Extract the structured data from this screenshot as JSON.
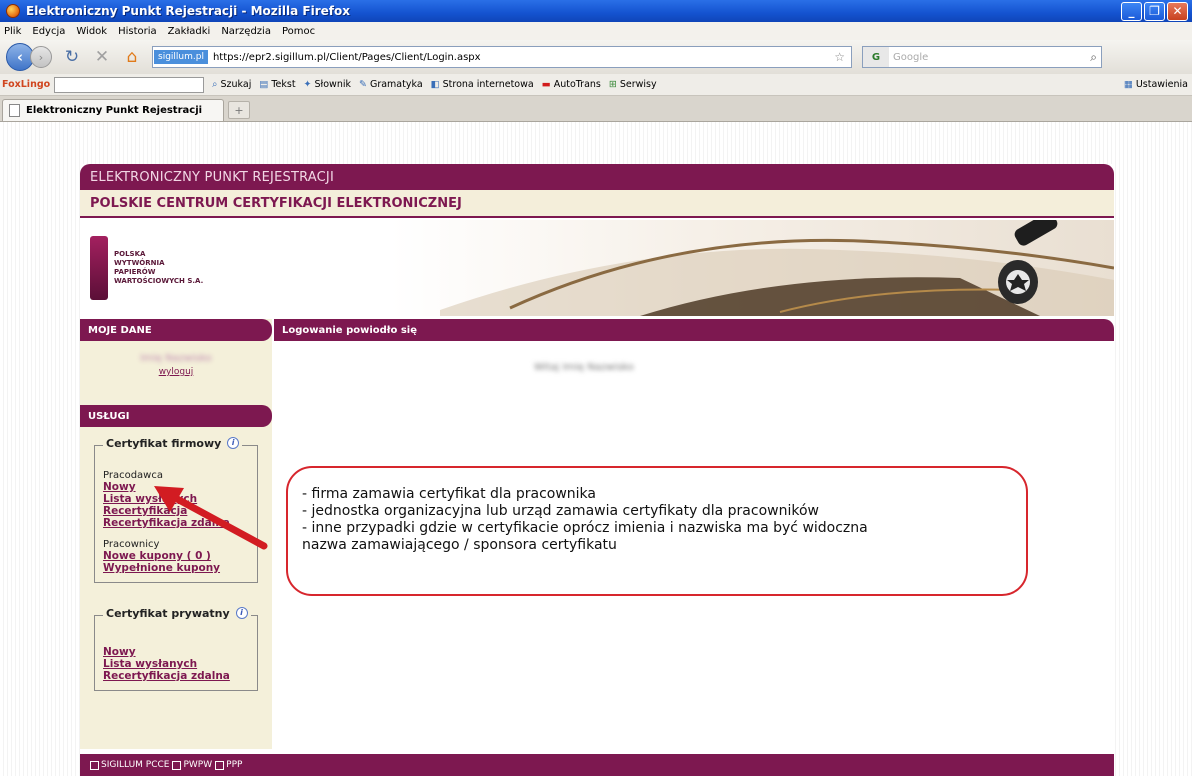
{
  "browser": {
    "title": "Elektroniczny Punkt Rejestracji - Mozilla Firefox",
    "menu": [
      "Plik",
      "Edycja",
      "Widok",
      "Historia",
      "Zakładki",
      "Narzędzia",
      "Pomoc"
    ],
    "site_identity": "sigillum.pl",
    "url": "https://epr2.sigillum.pl/Client/Pages/Client/Login.aspx",
    "search_placeholder": "Google",
    "foxlingo": {
      "brand": "FoxLingo",
      "items": [
        "Szukaj",
        "Tekst",
        "Słownik",
        "Gramatyka",
        "Strona internetowa",
        "AutoTrans",
        "Serwisy"
      ],
      "settings": "Ustawienia"
    },
    "tab_title": "Elektroniczny Punkt Rejestracji",
    "new_tab": "+"
  },
  "page": {
    "header_top": "ELEKTRONICZNY PUNKT REJESTRACJI",
    "header_title": "POLSKIE CENTRUM CERTYFIKACJI ELEKTRONICZNEJ",
    "sigillum_logo": "Sigillum",
    "pwpw_logo_lines": [
      "POLSKA",
      "WYTWÓRNIA",
      "PAPIERÓW",
      "WARTOŚCIOWYCH S.A."
    ],
    "sidebar": {
      "my_data_heading": "MOJE DANE",
      "logout_link": "wyloguj",
      "services_heading": "USŁUGI",
      "company_cert": {
        "title": "Certyfikat firmowy",
        "employer_label": "Pracodawca",
        "employer_links": [
          "Nowy",
          "Lista wysłanych",
          "Recertyfikacja",
          "Recertyfikacja zdalna"
        ],
        "employees_label": "Pracownicy",
        "employees_links": [
          "Nowe kupony ( 0 )",
          "Wypełnione kupony"
        ]
      },
      "private_cert": {
        "title": "Certyfikat prywatny",
        "links": [
          "Nowy",
          "Lista wysłanych",
          "Recertyfikacja zdalna"
        ]
      }
    },
    "content_heading": "Logowanie powiodło się",
    "callout_lines": [
      "- firma zamawia certyfikat dla pracownika",
      "- jednostka organizacyjna lub urząd zamawia certyfikaty dla pracowników",
      "- inne przypadki gdzie w certyfikacie oprócz imienia i nazwiska ma być widoczna",
      "nazwa zamawiającego / sponsora certyfikatu"
    ],
    "footer": [
      "SIGILLUM PCCE",
      "PWPW",
      "PPP"
    ]
  }
}
